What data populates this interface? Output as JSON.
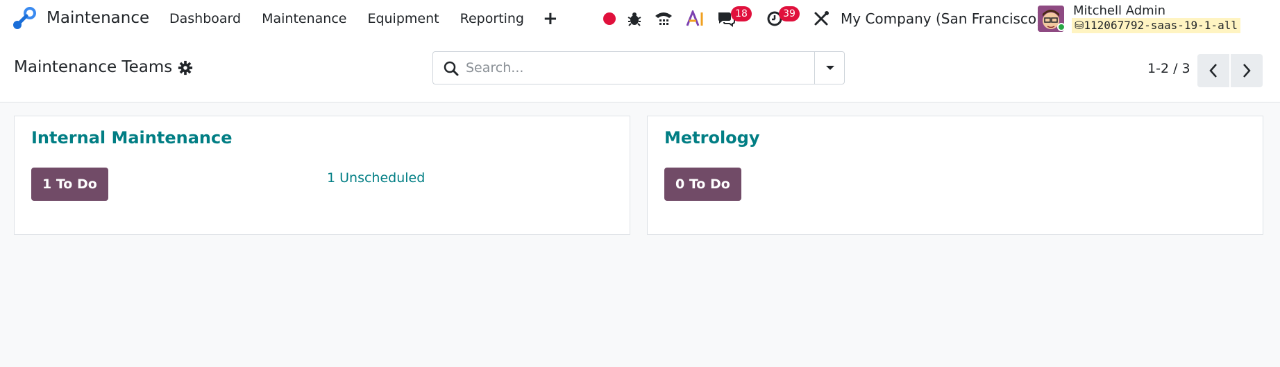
{
  "navbar": {
    "app_name": "Maintenance",
    "menu": [
      "Dashboard",
      "Maintenance",
      "Equipment",
      "Reporting"
    ],
    "plus_label": "+",
    "discuss_badge": "18",
    "activity_badge": "39",
    "company": "My Company (San Francisco)",
    "user_name": "Mitchell Admin",
    "database": "112067792-saas-19-1-all"
  },
  "control_panel": {
    "title": "Maintenance Teams",
    "search_placeholder": "Search...",
    "pager": "1-2 / 3"
  },
  "teams": [
    {
      "name": "Internal Maintenance",
      "todo_label": "1 To Do",
      "unscheduled_label": "1 Unscheduled"
    },
    {
      "name": "Metrology",
      "todo_label": "0 To Do"
    }
  ],
  "colors": {
    "primary": "#714b67",
    "link": "#017e84",
    "badge": "#e0103c",
    "record_dot": "#e0103c"
  }
}
